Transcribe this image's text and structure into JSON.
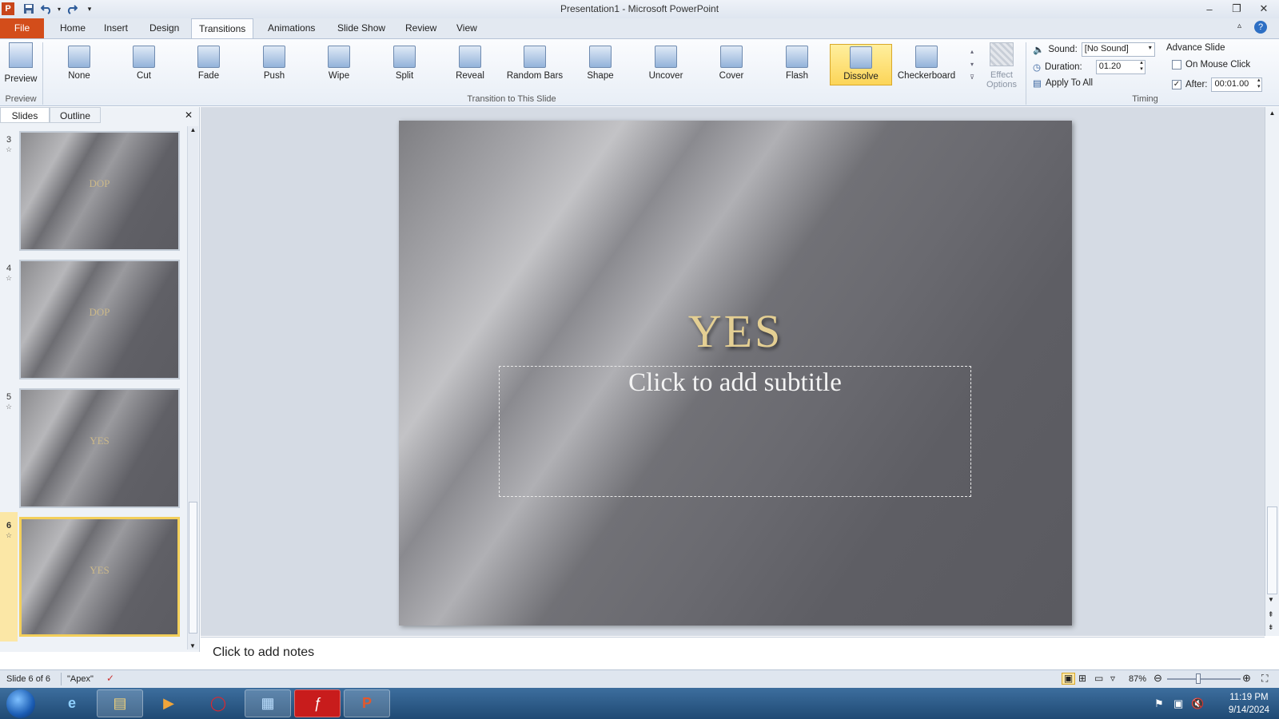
{
  "window": {
    "title": "Presentation1  -  Microsoft PowerPoint",
    "app_icon": "P"
  },
  "qat": {
    "save": "save-icon",
    "undo": "undo-icon",
    "redo": "redo-icon",
    "customize": "customize-qat-icon"
  },
  "tabs": [
    {
      "label": "File"
    },
    {
      "label": "Home"
    },
    {
      "label": "Insert"
    },
    {
      "label": "Design"
    },
    {
      "label": "Transitions"
    },
    {
      "label": "Animations"
    },
    {
      "label": "Slide Show"
    },
    {
      "label": "Review"
    },
    {
      "label": "View"
    }
  ],
  "ribbon": {
    "preview": {
      "label": "Preview",
      "group": "Preview"
    },
    "transitions": [
      {
        "label": "None"
      },
      {
        "label": "Cut"
      },
      {
        "label": "Fade"
      },
      {
        "label": "Push"
      },
      {
        "label": "Wipe"
      },
      {
        "label": "Split"
      },
      {
        "label": "Reveal"
      },
      {
        "label": "Random Bars"
      },
      {
        "label": "Shape"
      },
      {
        "label": "Uncover"
      },
      {
        "label": "Cover"
      },
      {
        "label": "Flash"
      },
      {
        "label": "Dissolve"
      },
      {
        "label": "Checkerboard"
      }
    ],
    "selected_transition": "Dissolve",
    "transition_group_label": "Transition to This Slide",
    "effect_options": {
      "line1": "Effect",
      "line2": "Options"
    },
    "timing": {
      "sound_label": "Sound:",
      "sound_value": "[No Sound]",
      "duration_label": "Duration:",
      "duration_value": "01.20",
      "apply_all": "Apply To All",
      "advance_title": "Advance Slide",
      "on_mouse_click": "On Mouse Click",
      "on_mouse_click_checked": false,
      "after_label": "After:",
      "after_checked": true,
      "after_value": "00:01.00",
      "group_label": "Timing"
    }
  },
  "left_pane": {
    "tabs": [
      {
        "label": "Slides"
      },
      {
        "label": "Outline"
      }
    ],
    "close": "✕",
    "thumbnails": [
      {
        "number": "3",
        "text": "DOP"
      },
      {
        "number": "4",
        "text": "DOP"
      },
      {
        "number": "5",
        "text": "YES"
      },
      {
        "number": "6",
        "text": "YES"
      }
    ],
    "selected_slide": "6"
  },
  "slide": {
    "title": "YES",
    "subtitle_placeholder": "Click to add subtitle"
  },
  "notes": {
    "placeholder": "Click to add notes"
  },
  "status": {
    "slide_info": "Slide 6 of 6",
    "theme": "\"Apex\"",
    "zoom": "87%",
    "zoom_level": 0.87
  },
  "taskbar": {
    "apps": [
      "start-orb-icon",
      "internet-explorer-icon",
      "file-explorer-icon",
      "media-player-icon",
      "opera-icon",
      "control-panel-icon",
      "flash-icon",
      "powerpoint-icon"
    ],
    "time": "11:19 PM",
    "date": "9/14/2024"
  },
  "colors": {
    "file_tab": "#d34d1a",
    "selected_gallery": "#fcd558",
    "title_gold": "#e4cf93"
  }
}
